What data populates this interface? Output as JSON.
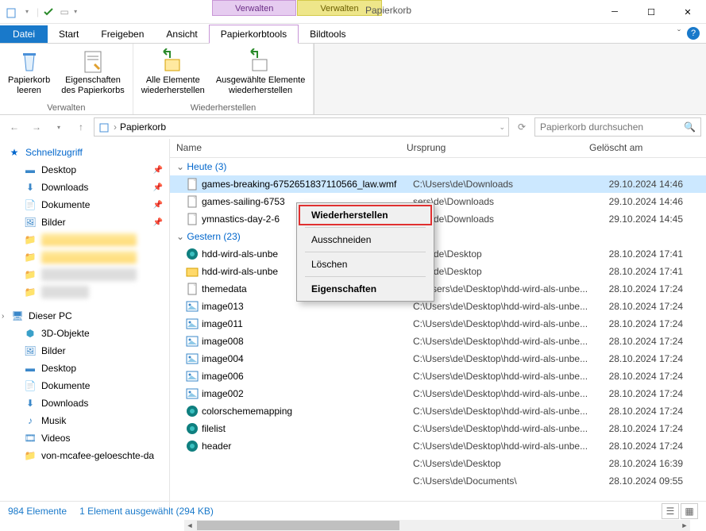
{
  "window": {
    "title": "Papierkorb",
    "manage1": "Verwalten",
    "manage2": "Verwalten"
  },
  "ribbon_tabs": {
    "file": "Datei",
    "start": "Start",
    "share": "Freigeben",
    "view": "Ansicht",
    "recycle_tools": "Papierkorbtools",
    "image_tools": "Bildtools"
  },
  "ribbon": {
    "empty": "Papierkorb\nleeren",
    "properties": "Eigenschaften\ndes Papierkorbs",
    "group1": "Verwalten",
    "restore_all": "Alle Elemente\nwiederherstellen",
    "restore_sel": "Ausgewählte Elemente\nwiederherstellen",
    "group2": "Wiederherstellen"
  },
  "address": {
    "path": "Papierkorb"
  },
  "search": {
    "placeholder": "Papierkorb durchsuchen"
  },
  "columns": {
    "name": "Name",
    "origin": "Ursprung",
    "deleted": "Gelöscht am"
  },
  "sidebar": {
    "quick": "Schnellzugriff",
    "desktop": "Desktop",
    "downloads": "Downloads",
    "documents": "Dokumente",
    "pictures": "Bilder",
    "thispc": "Dieser PC",
    "objects3d": "3D-Objekte",
    "pictures2": "Bilder",
    "desktop2": "Desktop",
    "documents2": "Dokumente",
    "downloads2": "Downloads",
    "music": "Musik",
    "videos": "Videos",
    "mcafee": "von-mcafee-geloeschte-da"
  },
  "groups": {
    "today": "Heute (3)",
    "yesterday": "Gestern (23)"
  },
  "files_today": [
    {
      "name": "games-breaking-6752651837110566_law.wmf",
      "origin": "C:\\Users\\de\\Downloads",
      "deleted": "29.10.2024 14:46"
    },
    {
      "name": "games-sailing-6753",
      "origin": "sers\\de\\Downloads",
      "deleted": "29.10.2024 14:46"
    },
    {
      "name": "ymnastics-day-2-6",
      "origin": "sers\\de\\Downloads",
      "deleted": "29.10.2024 14:45"
    }
  ],
  "files_yesterday": [
    {
      "name": "hdd-wird-als-unbe",
      "origin": "sers\\de\\Desktop",
      "deleted": "28.10.2024 17:41",
      "icon": "edge"
    },
    {
      "name": "hdd-wird-als-unbe",
      "origin": "sers\\de\\Desktop",
      "deleted": "28.10.2024 17:41",
      "icon": "folder"
    },
    {
      "name": "themedata",
      "origin": "C:\\Users\\de\\Desktop\\hdd-wird-als-unbe...",
      "deleted": "28.10.2024 17:24",
      "icon": "file"
    },
    {
      "name": "image013",
      "origin": "C:\\Users\\de\\Desktop\\hdd-wird-als-unbe...",
      "deleted": "28.10.2024 17:24",
      "icon": "img"
    },
    {
      "name": "image011",
      "origin": "C:\\Users\\de\\Desktop\\hdd-wird-als-unbe...",
      "deleted": "28.10.2024 17:24",
      "icon": "img"
    },
    {
      "name": "image008",
      "origin": "C:\\Users\\de\\Desktop\\hdd-wird-als-unbe...",
      "deleted": "28.10.2024 17:24",
      "icon": "img"
    },
    {
      "name": "image004",
      "origin": "C:\\Users\\de\\Desktop\\hdd-wird-als-unbe...",
      "deleted": "28.10.2024 17:24",
      "icon": "img"
    },
    {
      "name": "image006",
      "origin": "C:\\Users\\de\\Desktop\\hdd-wird-als-unbe...",
      "deleted": "28.10.2024 17:24",
      "icon": "img"
    },
    {
      "name": "image002",
      "origin": "C:\\Users\\de\\Desktop\\hdd-wird-als-unbe...",
      "deleted": "28.10.2024 17:24",
      "icon": "img"
    },
    {
      "name": "colorschememapping",
      "origin": "C:\\Users\\de\\Desktop\\hdd-wird-als-unbe...",
      "deleted": "28.10.2024 17:24",
      "icon": "edge"
    },
    {
      "name": "filelist",
      "origin": "C:\\Users\\de\\Desktop\\hdd-wird-als-unbe...",
      "deleted": "28.10.2024 17:24",
      "icon": "edge"
    },
    {
      "name": "header",
      "origin": "C:\\Users\\de\\Desktop\\hdd-wird-als-unbe...",
      "deleted": "28.10.2024 17:24",
      "icon": "edge"
    },
    {
      "name": "",
      "origin": "C:\\Users\\de\\Desktop",
      "deleted": "28.10.2024 16:39",
      "icon": "blur"
    },
    {
      "name": "",
      "origin": "C:\\Users\\de\\Documents\\",
      "deleted": "28.10.2024 09:55",
      "icon": "blur"
    }
  ],
  "context": {
    "restore": "Wiederherstellen",
    "cut": "Ausschneiden",
    "delete": "Löschen",
    "properties": "Eigenschaften"
  },
  "status": {
    "count": "984 Elemente",
    "selection": "1 Element ausgewählt (294 KB)"
  }
}
